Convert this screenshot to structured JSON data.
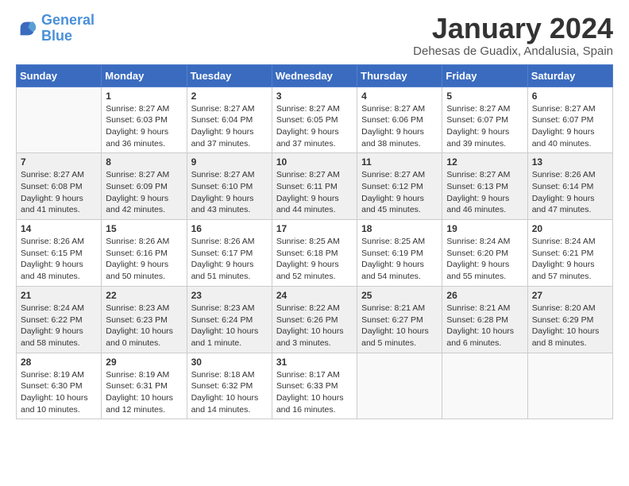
{
  "logo": {
    "line1": "General",
    "line2": "Blue"
  },
  "title": "January 2024",
  "subtitle": "Dehesas de Guadix, Andalusia, Spain",
  "days_of_week": [
    "Sunday",
    "Monday",
    "Tuesday",
    "Wednesday",
    "Thursday",
    "Friday",
    "Saturday"
  ],
  "weeks": [
    [
      {
        "day": "",
        "empty": true
      },
      {
        "day": "1",
        "sunrise": "Sunrise: 8:27 AM",
        "sunset": "Sunset: 6:03 PM",
        "daylight": "Daylight: 9 hours and 36 minutes."
      },
      {
        "day": "2",
        "sunrise": "Sunrise: 8:27 AM",
        "sunset": "Sunset: 6:04 PM",
        "daylight": "Daylight: 9 hours and 37 minutes."
      },
      {
        "day": "3",
        "sunrise": "Sunrise: 8:27 AM",
        "sunset": "Sunset: 6:05 PM",
        "daylight": "Daylight: 9 hours and 37 minutes."
      },
      {
        "day": "4",
        "sunrise": "Sunrise: 8:27 AM",
        "sunset": "Sunset: 6:06 PM",
        "daylight": "Daylight: 9 hours and 38 minutes."
      },
      {
        "day": "5",
        "sunrise": "Sunrise: 8:27 AM",
        "sunset": "Sunset: 6:07 PM",
        "daylight": "Daylight: 9 hours and 39 minutes."
      },
      {
        "day": "6",
        "sunrise": "Sunrise: 8:27 AM",
        "sunset": "Sunset: 6:07 PM",
        "daylight": "Daylight: 9 hours and 40 minutes."
      }
    ],
    [
      {
        "day": "7",
        "sunrise": "Sunrise: 8:27 AM",
        "sunset": "Sunset: 6:08 PM",
        "daylight": "Daylight: 9 hours and 41 minutes."
      },
      {
        "day": "8",
        "sunrise": "Sunrise: 8:27 AM",
        "sunset": "Sunset: 6:09 PM",
        "daylight": "Daylight: 9 hours and 42 minutes."
      },
      {
        "day": "9",
        "sunrise": "Sunrise: 8:27 AM",
        "sunset": "Sunset: 6:10 PM",
        "daylight": "Daylight: 9 hours and 43 minutes."
      },
      {
        "day": "10",
        "sunrise": "Sunrise: 8:27 AM",
        "sunset": "Sunset: 6:11 PM",
        "daylight": "Daylight: 9 hours and 44 minutes."
      },
      {
        "day": "11",
        "sunrise": "Sunrise: 8:27 AM",
        "sunset": "Sunset: 6:12 PM",
        "daylight": "Daylight: 9 hours and 45 minutes."
      },
      {
        "day": "12",
        "sunrise": "Sunrise: 8:27 AM",
        "sunset": "Sunset: 6:13 PM",
        "daylight": "Daylight: 9 hours and 46 minutes."
      },
      {
        "day": "13",
        "sunrise": "Sunrise: 8:26 AM",
        "sunset": "Sunset: 6:14 PM",
        "daylight": "Daylight: 9 hours and 47 minutes."
      }
    ],
    [
      {
        "day": "14",
        "sunrise": "Sunrise: 8:26 AM",
        "sunset": "Sunset: 6:15 PM",
        "daylight": "Daylight: 9 hours and 48 minutes."
      },
      {
        "day": "15",
        "sunrise": "Sunrise: 8:26 AM",
        "sunset": "Sunset: 6:16 PM",
        "daylight": "Daylight: 9 hours and 50 minutes."
      },
      {
        "day": "16",
        "sunrise": "Sunrise: 8:26 AM",
        "sunset": "Sunset: 6:17 PM",
        "daylight": "Daylight: 9 hours and 51 minutes."
      },
      {
        "day": "17",
        "sunrise": "Sunrise: 8:25 AM",
        "sunset": "Sunset: 6:18 PM",
        "daylight": "Daylight: 9 hours and 52 minutes."
      },
      {
        "day": "18",
        "sunrise": "Sunrise: 8:25 AM",
        "sunset": "Sunset: 6:19 PM",
        "daylight": "Daylight: 9 hours and 54 minutes."
      },
      {
        "day": "19",
        "sunrise": "Sunrise: 8:24 AM",
        "sunset": "Sunset: 6:20 PM",
        "daylight": "Daylight: 9 hours and 55 minutes."
      },
      {
        "day": "20",
        "sunrise": "Sunrise: 8:24 AM",
        "sunset": "Sunset: 6:21 PM",
        "daylight": "Daylight: 9 hours and 57 minutes."
      }
    ],
    [
      {
        "day": "21",
        "sunrise": "Sunrise: 8:24 AM",
        "sunset": "Sunset: 6:22 PM",
        "daylight": "Daylight: 9 hours and 58 minutes."
      },
      {
        "day": "22",
        "sunrise": "Sunrise: 8:23 AM",
        "sunset": "Sunset: 6:23 PM",
        "daylight": "Daylight: 10 hours and 0 minutes."
      },
      {
        "day": "23",
        "sunrise": "Sunrise: 8:23 AM",
        "sunset": "Sunset: 6:24 PM",
        "daylight": "Daylight: 10 hours and 1 minute."
      },
      {
        "day": "24",
        "sunrise": "Sunrise: 8:22 AM",
        "sunset": "Sunset: 6:26 PM",
        "daylight": "Daylight: 10 hours and 3 minutes."
      },
      {
        "day": "25",
        "sunrise": "Sunrise: 8:21 AM",
        "sunset": "Sunset: 6:27 PM",
        "daylight": "Daylight: 10 hours and 5 minutes."
      },
      {
        "day": "26",
        "sunrise": "Sunrise: 8:21 AM",
        "sunset": "Sunset: 6:28 PM",
        "daylight": "Daylight: 10 hours and 6 minutes."
      },
      {
        "day": "27",
        "sunrise": "Sunrise: 8:20 AM",
        "sunset": "Sunset: 6:29 PM",
        "daylight": "Daylight: 10 hours and 8 minutes."
      }
    ],
    [
      {
        "day": "28",
        "sunrise": "Sunrise: 8:19 AM",
        "sunset": "Sunset: 6:30 PM",
        "daylight": "Daylight: 10 hours and 10 minutes."
      },
      {
        "day": "29",
        "sunrise": "Sunrise: 8:19 AM",
        "sunset": "Sunset: 6:31 PM",
        "daylight": "Daylight: 10 hours and 12 minutes."
      },
      {
        "day": "30",
        "sunrise": "Sunrise: 8:18 AM",
        "sunset": "Sunset: 6:32 PM",
        "daylight": "Daylight: 10 hours and 14 minutes."
      },
      {
        "day": "31",
        "sunrise": "Sunrise: 8:17 AM",
        "sunset": "Sunset: 6:33 PM",
        "daylight": "Daylight: 10 hours and 16 minutes."
      },
      {
        "day": "",
        "empty": true
      },
      {
        "day": "",
        "empty": true
      },
      {
        "day": "",
        "empty": true
      }
    ]
  ]
}
